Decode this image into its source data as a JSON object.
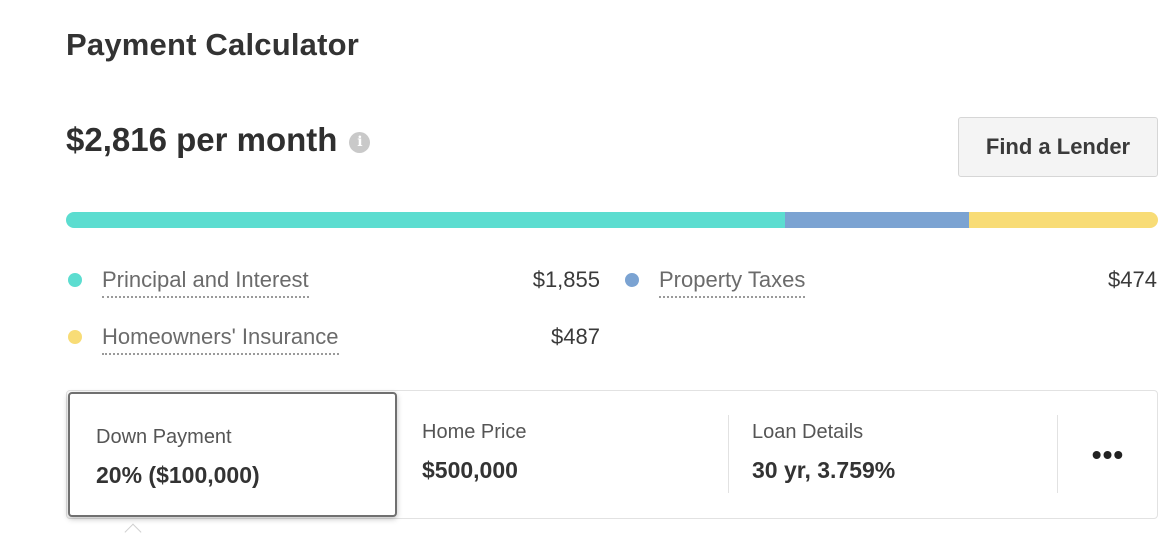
{
  "header": {
    "title": "Payment Calculator"
  },
  "summary": {
    "monthly_payment": "$2,816 per month",
    "info_icon": "i",
    "find_lender_label": "Find a Lender"
  },
  "breakdown": {
    "segments": [
      {
        "name": "Principal and Interest",
        "value": 1855,
        "color": "#5cddd0"
      },
      {
        "name": "Property Taxes",
        "value": 474,
        "color": "#7ba3d2"
      },
      {
        "name": "Homeowners' Insurance",
        "value": 487,
        "color": "#f8dc76"
      }
    ],
    "items": [
      {
        "label": "Principal and Interest",
        "amount": "$1,855",
        "color": "#5cddd0"
      },
      {
        "label": "Property Taxes",
        "amount": "$474",
        "color": "#7ba3d2"
      },
      {
        "label": "Homeowners' Insurance",
        "amount": "$487",
        "color": "#f8dc76"
      }
    ]
  },
  "inputs": {
    "down_payment": {
      "label": "Down Payment",
      "value": "20% ($100,000)"
    },
    "home_price": {
      "label": "Home Price",
      "value": "$500,000"
    },
    "loan_details": {
      "label": "Loan Details",
      "value": "30 yr, 3.759%"
    },
    "more_label": "•••"
  }
}
